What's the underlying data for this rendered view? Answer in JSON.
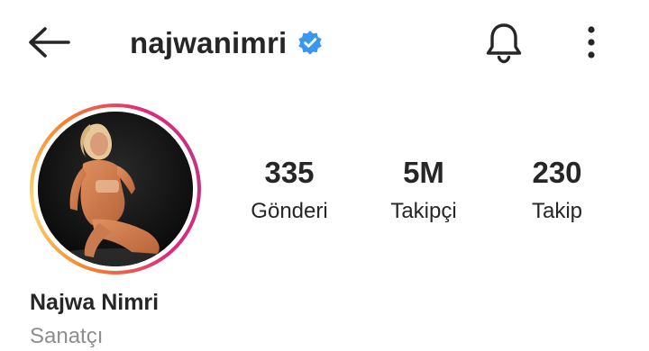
{
  "header": {
    "username": "najwanimri",
    "back_icon": "arrow-left-icon",
    "verified_icon": "verified-badge-icon",
    "verified_color": "#3897f0",
    "bell_icon": "bell-icon",
    "more_icon": "more-vertical-icon"
  },
  "profile": {
    "stats": [
      {
        "value": "335",
        "label": "Gönderi"
      },
      {
        "value": "5M",
        "label": "Takipçi"
      },
      {
        "value": "230",
        "label": "Takip"
      }
    ],
    "display_name": "Najwa Nimri",
    "category": "Sanatçı",
    "story_ring_colors": [
      "#f58529",
      "#feda77",
      "#dd2a7b",
      "#c13584"
    ]
  }
}
